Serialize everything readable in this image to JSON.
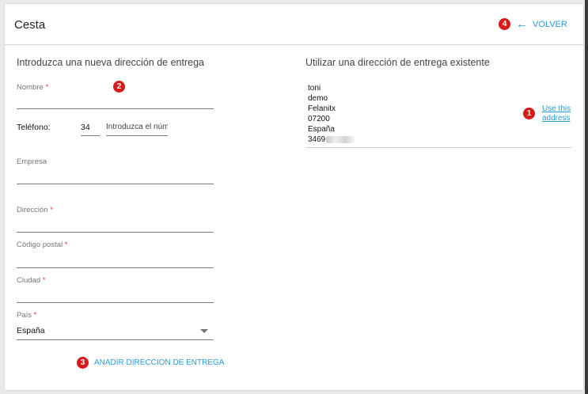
{
  "header": {
    "title": "Cesta",
    "back_label": "VOLVER",
    "back_icon": "arrow-left-icon"
  },
  "new_address": {
    "heading": "Introduzca una nueva dirección de entrega",
    "nombre_label": "Nombre",
    "telefono_label": "Teléfono:",
    "phone_prefix": "34",
    "phone_placeholder": "Introduzca el núm",
    "empresa_label": "Empresa",
    "direccion_label": "Dirección",
    "postal_label": "Código postal",
    "ciudad_label": "Ciudad",
    "pais_label": "País",
    "pais_value": "España",
    "required_mark": "*",
    "add_button": "ANADIR DIRECCION DE ENTREGA"
  },
  "existing_address": {
    "heading": "Utilizar una dirección de entrega existente",
    "lines": [
      "toni",
      "demo",
      "Felanitx",
      "07200",
      "España"
    ],
    "phone_visible": "3469",
    "use_line1": "Use this",
    "use_line2": "address"
  },
  "badges": [
    "1",
    "2",
    "3",
    "4"
  ],
  "colors": {
    "accent": "#2a9ad8",
    "badge": "#d81a1a",
    "required": "#e53935"
  }
}
